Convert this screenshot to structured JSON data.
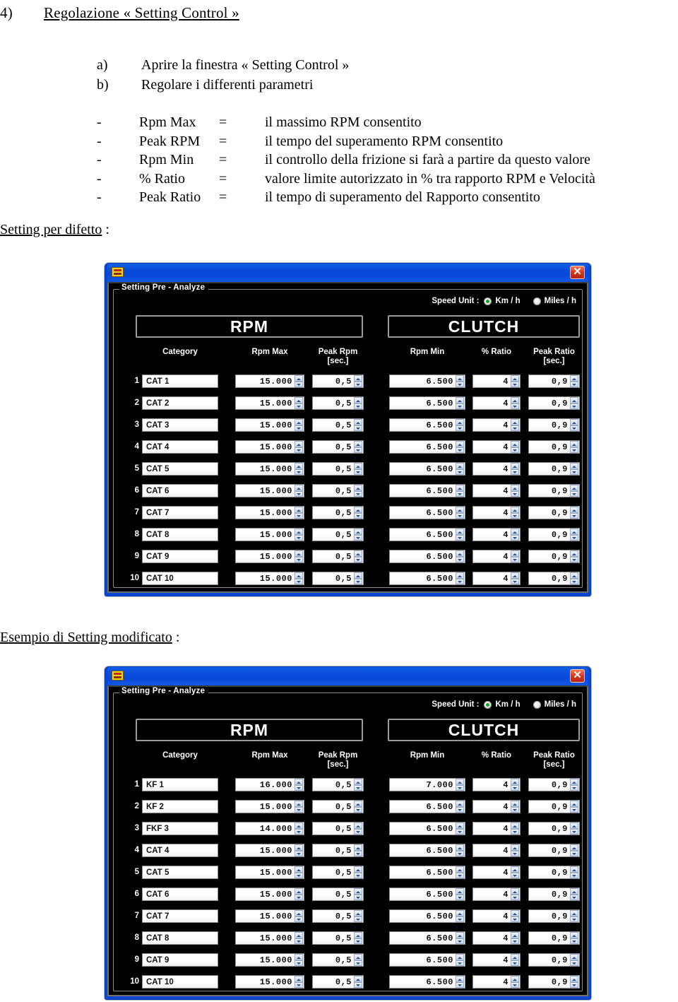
{
  "document": {
    "heading": {
      "number": "4)",
      "text": "Regolazione  « Setting Control »"
    },
    "steps": [
      {
        "marker": "a)",
        "text": "Aprire la finestra « Setting Control »"
      },
      {
        "marker": "b)",
        "text": "Regolare i differenti parametri"
      }
    ],
    "parameters": [
      {
        "dash": "-",
        "name": "Rpm Max",
        "eq": "=",
        "description": "il massimo RPM consentito"
      },
      {
        "dash": "-",
        "name": "Peak RPM",
        "eq": "=",
        "description": "il tempo del superamento RPM consentito"
      },
      {
        "dash": "-",
        "name": "Rpm Min",
        "eq": "=",
        "description": "il controllo della frizione si farà a partire da questo valore"
      },
      {
        "dash": "-",
        "name": "% Ratio",
        "eq": "=",
        "description": "valore limite autorizzato in % tra rapporto RPM e Velocità"
      },
      {
        "dash": "-",
        "name": "Peak Ratio",
        "eq": "=",
        "description": "il tempo di superamento del Rapporto consentito"
      }
    ],
    "labels": {
      "default_setting": "Setting per difetto",
      "default_setting_suffix": " :",
      "modified_setting": "Esempio di Setting modificato",
      "modified_setting_suffix": " :"
    }
  },
  "dialog_common": {
    "icon": "app-icon",
    "close_label": "✕",
    "group_title": "Setting Pre - Analyze",
    "speed_unit": {
      "label": "Speed Unit :",
      "options": [
        {
          "label": "Km / h",
          "selected": true
        },
        {
          "label": "Miles / h",
          "selected": false
        }
      ]
    },
    "banners": {
      "rpm": "RPM",
      "clutch": "CLUTCH"
    },
    "columns": {
      "category": "Category",
      "rpm_max": "Rpm Max",
      "peak_rpm": "Peak Rpm",
      "peak_rpm_unit": "[sec.]",
      "rpm_min": "Rpm Min",
      "pct_ratio": "% Ratio",
      "peak_ratio": "Peak Ratio",
      "peak_ratio_unit": "[sec.]"
    },
    "accent_title_bar": "#0a4ede",
    "accent_selected_radio": "#13a81f",
    "accent_close_button": "#d8381c"
  },
  "dialog_default": {
    "rows": [
      {
        "n": "1",
        "category": "CAT 1",
        "rpm_max": "15.000",
        "peak_rpm": "0,5",
        "rpm_min": "6.500",
        "pct_ratio": "4",
        "peak_ratio": "0,9"
      },
      {
        "n": "2",
        "category": "CAT 2",
        "rpm_max": "15.000",
        "peak_rpm": "0,5",
        "rpm_min": "6.500",
        "pct_ratio": "4",
        "peak_ratio": "0,9"
      },
      {
        "n": "3",
        "category": "CAT 3",
        "rpm_max": "15.000",
        "peak_rpm": "0,5",
        "rpm_min": "6.500",
        "pct_ratio": "4",
        "peak_ratio": "0,9"
      },
      {
        "n": "4",
        "category": "CAT 4",
        "rpm_max": "15.000",
        "peak_rpm": "0,5",
        "rpm_min": "6.500",
        "pct_ratio": "4",
        "peak_ratio": "0,9"
      },
      {
        "n": "5",
        "category": "CAT 5",
        "rpm_max": "15.000",
        "peak_rpm": "0,5",
        "rpm_min": "6.500",
        "pct_ratio": "4",
        "peak_ratio": "0,9"
      },
      {
        "n": "6",
        "category": "CAT 6",
        "rpm_max": "15.000",
        "peak_rpm": "0,5",
        "rpm_min": "6.500",
        "pct_ratio": "4",
        "peak_ratio": "0,9"
      },
      {
        "n": "7",
        "category": "CAT 7",
        "rpm_max": "15.000",
        "peak_rpm": "0,5",
        "rpm_min": "6.500",
        "pct_ratio": "4",
        "peak_ratio": "0,9"
      },
      {
        "n": "8",
        "category": "CAT 8",
        "rpm_max": "15.000",
        "peak_rpm": "0,5",
        "rpm_min": "6.500",
        "pct_ratio": "4",
        "peak_ratio": "0,9"
      },
      {
        "n": "9",
        "category": "CAT 9",
        "rpm_max": "15.000",
        "peak_rpm": "0,5",
        "rpm_min": "6.500",
        "pct_ratio": "4",
        "peak_ratio": "0,9"
      },
      {
        "n": "10",
        "category": "CAT 10",
        "rpm_max": "15.000",
        "peak_rpm": "0,5",
        "rpm_min": "6.500",
        "pct_ratio": "4",
        "peak_ratio": "0,9"
      }
    ]
  },
  "dialog_modified": {
    "rows": [
      {
        "n": "1",
        "category": "KF 1",
        "rpm_max": "16.000",
        "peak_rpm": "0,5",
        "rpm_min": "7.000",
        "pct_ratio": "4",
        "peak_ratio": "0,9"
      },
      {
        "n": "2",
        "category": "KF 2",
        "rpm_max": "15.000",
        "peak_rpm": "0,5",
        "rpm_min": "6.500",
        "pct_ratio": "4",
        "peak_ratio": "0,9"
      },
      {
        "n": "3",
        "category": "FKF 3",
        "rpm_max": "14.000",
        "peak_rpm": "0,5",
        "rpm_min": "6.500",
        "pct_ratio": "4",
        "peak_ratio": "0,9"
      },
      {
        "n": "4",
        "category": "CAT 4",
        "rpm_max": "15.000",
        "peak_rpm": "0,5",
        "rpm_min": "6.500",
        "pct_ratio": "4",
        "peak_ratio": "0,9"
      },
      {
        "n": "5",
        "category": "CAT 5",
        "rpm_max": "15.000",
        "peak_rpm": "0,5",
        "rpm_min": "6.500",
        "pct_ratio": "4",
        "peak_ratio": "0,9"
      },
      {
        "n": "6",
        "category": "CAT 6",
        "rpm_max": "15.000",
        "peak_rpm": "0,5",
        "rpm_min": "6.500",
        "pct_ratio": "4",
        "peak_ratio": "0,9"
      },
      {
        "n": "7",
        "category": "CAT 7",
        "rpm_max": "15.000",
        "peak_rpm": "0,5",
        "rpm_min": "6.500",
        "pct_ratio": "4",
        "peak_ratio": "0,9"
      },
      {
        "n": "8",
        "category": "CAT 8",
        "rpm_max": "15.000",
        "peak_rpm": "0,5",
        "rpm_min": "6.500",
        "pct_ratio": "4",
        "peak_ratio": "0,9"
      },
      {
        "n": "9",
        "category": "CAT 9",
        "rpm_max": "15.000",
        "peak_rpm": "0,5",
        "rpm_min": "6.500",
        "pct_ratio": "4",
        "peak_ratio": "0,9"
      },
      {
        "n": "10",
        "category": "CAT 10",
        "rpm_max": "15.000",
        "peak_rpm": "0,5",
        "rpm_min": "6.500",
        "pct_ratio": "4",
        "peak_ratio": "0,9"
      }
    ]
  }
}
